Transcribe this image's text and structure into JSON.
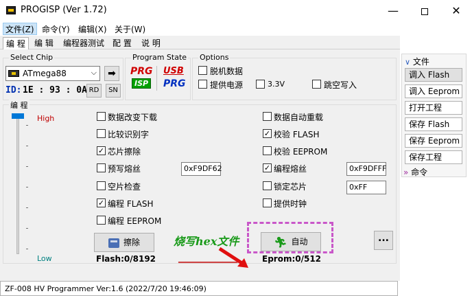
{
  "window": {
    "title": "PROGISP  (Ver 1.72)",
    "minimize": "—",
    "close": "✕"
  },
  "menu": [
    "文件(Z)",
    "命令(Y)",
    "编辑(X)",
    "关于(W)"
  ],
  "tabs": [
    "编 程",
    "编 辑",
    "编程器测试",
    "配 置",
    "说 明"
  ],
  "select_chip": {
    "label": "Select Chip",
    "value": "ATmega88",
    "go": "➡"
  },
  "id": {
    "label": "ID:",
    "value": "1E : 93 : 0A",
    "rd": "RD",
    "sn": "SN"
  },
  "program_state": {
    "label": "Program State",
    "prg1": "PRG",
    "isp": "ISP",
    "usb": "USB",
    "prg2": "PRG"
  },
  "options": {
    "label": "Options",
    "offline": "脱机数据",
    "power": "提供电源",
    "v33": "3.3V",
    "jump": "跳空写入"
  },
  "prog_group": {
    "label": "编 程",
    "high": "High",
    "low": "Low"
  },
  "checkboxes_left": [
    {
      "label": "数据改变下载",
      "checked": false
    },
    {
      "label": "比较识别字",
      "checked": false
    },
    {
      "label": "芯片擦除",
      "checked": true
    },
    {
      "label": "预写熔丝",
      "checked": false
    },
    {
      "label": "空片检查",
      "checked": false
    },
    {
      "label": "编程 FLASH",
      "checked": true
    },
    {
      "label": "编程 EEPROM",
      "checked": false
    }
  ],
  "checkboxes_right": [
    {
      "label": "数据自动重载",
      "checked": false
    },
    {
      "label": "校验 FLASH",
      "checked": true
    },
    {
      "label": "校验 EEPROM",
      "checked": false
    },
    {
      "label": "编程熔丝",
      "checked": true
    },
    {
      "label": "锁定芯片",
      "checked": false
    },
    {
      "label": "提供时钟",
      "checked": false
    }
  ],
  "fuses": {
    "prewrite": "0xF9DF62",
    "program": "0xF9DFFF",
    "lock": "0xFF"
  },
  "buttons": {
    "erase": "擦除",
    "auto": "自动",
    "more": "..."
  },
  "annotation": "烧写hex文件",
  "stats": {
    "flash": "Flash:0/8192",
    "eprom": "Eprom:0/512"
  },
  "status": "ZF-008 HV Programmer Ver:1.6 (2022/7/20 19:46:09)",
  "sidebar": {
    "file_header": "文件",
    "items": [
      "调入 Flash",
      "调入 Eeprom",
      "打开工程",
      "保存 Flash",
      "保存 Eeprom",
      "保存工程"
    ],
    "cmd_header": "命令"
  }
}
